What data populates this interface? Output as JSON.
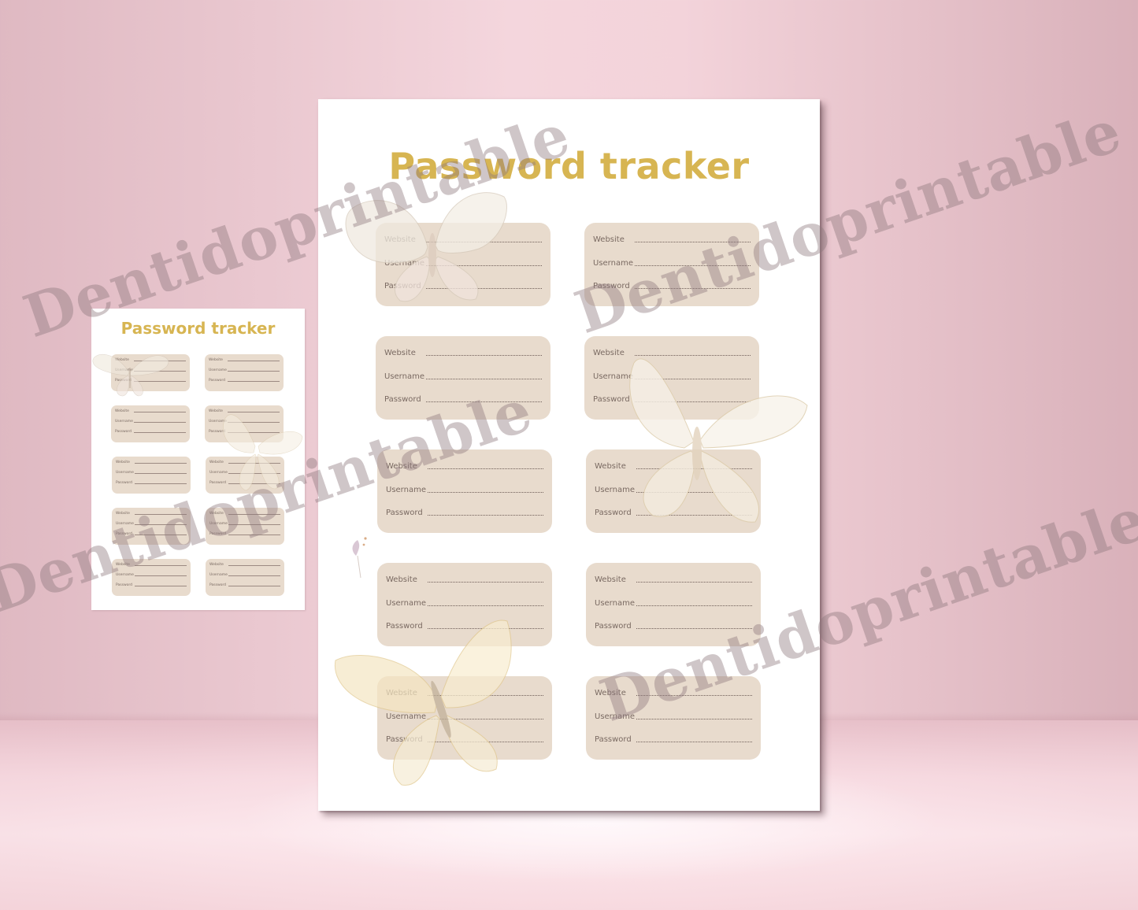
{
  "scene": {
    "background_color": "#efc9d1",
    "title_color": "#d7b552",
    "card_color": "#e8dbcd",
    "label_color": "#7a6a62"
  },
  "main_sheet": {
    "title": "Password tracker",
    "cards": [
      {
        "fields": [
          "Website",
          "Username",
          "Password"
        ]
      },
      {
        "fields": [
          "Website",
          "Username",
          "Password"
        ]
      },
      {
        "fields": [
          "Website",
          "Username",
          "Password"
        ]
      },
      {
        "fields": [
          "Website",
          "Username",
          "Password"
        ]
      },
      {
        "fields": [
          "Website",
          "Username",
          "Password"
        ]
      },
      {
        "fields": [
          "Website",
          "Username",
          "Password"
        ]
      },
      {
        "fields": [
          "Website",
          "Username",
          "Password"
        ]
      },
      {
        "fields": [
          "Website",
          "Username",
          "Password"
        ]
      },
      {
        "fields": [
          "Website",
          "Username",
          "Password"
        ]
      },
      {
        "fields": [
          "Website",
          "Username",
          "Password"
        ]
      }
    ]
  },
  "thumb_sheet": {
    "title": "Password tracker",
    "cards": [
      {
        "fields": [
          "Website",
          "Username",
          "Password"
        ]
      },
      {
        "fields": [
          "Website",
          "Username",
          "Password"
        ]
      },
      {
        "fields": [
          "Website",
          "Username",
          "Password"
        ]
      },
      {
        "fields": [
          "Website",
          "Username",
          "Password"
        ]
      },
      {
        "fields": [
          "Website",
          "Username",
          "Password"
        ]
      },
      {
        "fields": [
          "Website",
          "Username",
          "Password"
        ]
      },
      {
        "fields": [
          "Website",
          "Username",
          "Password"
        ]
      },
      {
        "fields": [
          "Website",
          "Username",
          "Password"
        ]
      },
      {
        "fields": [
          "Website",
          "Username",
          "Password"
        ]
      },
      {
        "fields": [
          "Website",
          "Username",
          "Password"
        ]
      }
    ]
  },
  "watermarks": [
    "Dentidoprintable",
    "Dentidoprintable",
    "Dentidoprintable",
    "Dentidoprintable",
    "Dentidoprintable",
    "Dentidoprintable"
  ],
  "decorations": [
    "butterfly-icon",
    "butterfly-icon",
    "butterfly-icon",
    "butterfly-icon"
  ]
}
